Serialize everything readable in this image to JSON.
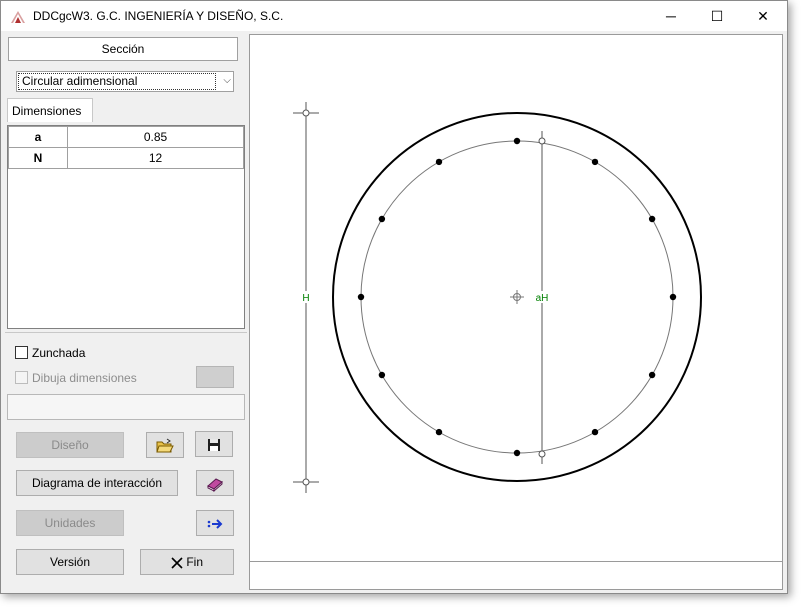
{
  "window": {
    "title": "DDCgcW3. G.C. INGENIERÍA Y DISEÑO, S.C.",
    "minimize": "─",
    "maximize": "☐",
    "close": "✕"
  },
  "section": {
    "header": "Sección",
    "selected": "Circular adimensional"
  },
  "dimensions": {
    "tab_label": "Dimensiones",
    "rows": [
      {
        "key": "a",
        "value": "0.85"
      },
      {
        "key": "N",
        "value": "12"
      }
    ]
  },
  "options": {
    "zunchada_label": "Zunchada",
    "zunchada_checked": false,
    "dibuja_label": "Dibuja dimensiones",
    "dibuja_checked": false
  },
  "buttons": {
    "diseno": "Diseño",
    "diagrama": "Diagrama de interacción",
    "unidades": "Unidades",
    "version": "Versión",
    "fin": "Fin"
  },
  "drawing": {
    "label_h": "H",
    "label_ah": "aH",
    "bar_count": 12,
    "ratio_a": 0.85
  },
  "icons": {
    "app": "ddc-app-icon",
    "open": "open-folder-icon",
    "save": "floppy-disk-icon",
    "book": "book-icon",
    "export": "export-arrow-icon",
    "fin": "x-mark-icon"
  },
  "colors": {
    "label_green": "#008000",
    "canvas": "#ffffff",
    "panel": "#f0f0f0"
  }
}
